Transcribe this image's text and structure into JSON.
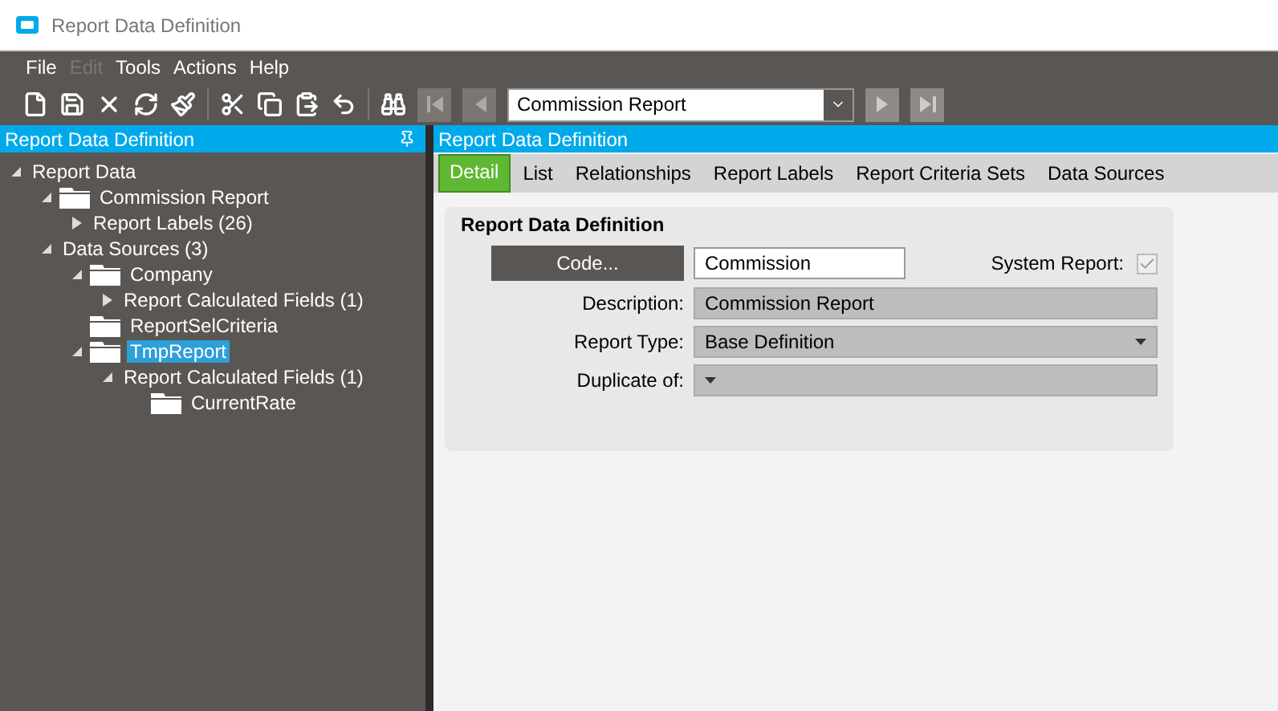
{
  "window": {
    "title": "Report Data Definition"
  },
  "menu": [
    {
      "label": "File",
      "disabled": false
    },
    {
      "label": "Edit",
      "disabled": true
    },
    {
      "label": "Tools",
      "disabled": false
    },
    {
      "label": "Actions",
      "disabled": false
    },
    {
      "label": "Help",
      "disabled": false
    }
  ],
  "toolbar": {
    "record_selector": {
      "value": "Commission Report"
    }
  },
  "tree_panel": {
    "title": "Report Data Definition",
    "tree": [
      {
        "label": "Report Data",
        "folder": false,
        "expanded": true,
        "selected": false,
        "children": [
          {
            "label": "Commission Report",
            "folder": true,
            "expanded": true,
            "selected": false,
            "children": [
              {
                "label": "Report Labels (26)",
                "folder": false,
                "expanded": false,
                "selected": false
              }
            ]
          },
          {
            "label": "Data Sources (3)",
            "folder": false,
            "expanded": true,
            "selected": false,
            "children": [
              {
                "label": "Company",
                "folder": true,
                "expanded": true,
                "selected": false,
                "children": [
                  {
                    "label": "Report Calculated Fields (1)",
                    "folder": false,
                    "expanded": false,
                    "selected": false
                  }
                ]
              },
              {
                "label": "ReportSelCriteria",
                "folder": true,
                "selected": false
              },
              {
                "label": "TmpReport",
                "folder": true,
                "expanded": true,
                "selected": true,
                "children": [
                  {
                    "label": "Report Calculated Fields (1)",
                    "folder": false,
                    "expanded": true,
                    "selected": false,
                    "children": [
                      {
                        "label": "CurrentRate",
                        "folder": true,
                        "selected": false
                      }
                    ]
                  }
                ]
              }
            ]
          }
        ]
      }
    ]
  },
  "detail_panel": {
    "title": "Report Data Definition",
    "tabs": [
      {
        "label": "Detail",
        "selected": true
      },
      {
        "label": "List",
        "selected": false
      },
      {
        "label": "Relationships",
        "selected": false
      },
      {
        "label": "Report Labels",
        "selected": false
      },
      {
        "label": "Report Criteria Sets",
        "selected": false
      },
      {
        "label": "Data Sources",
        "selected": false
      }
    ],
    "group_title": "Report Data Definition",
    "code_button": "Code...",
    "code_value": "Commission",
    "system_report": {
      "label": "System Report:",
      "checked": true
    },
    "fields": [
      {
        "label": "Description:",
        "value": "Commission Report",
        "kind": "text"
      },
      {
        "label": "Report Type:",
        "value": "Base Definition",
        "kind": "dropdown"
      },
      {
        "label": "Duplicate of:",
        "kind": "dropdown"
      }
    ]
  }
}
